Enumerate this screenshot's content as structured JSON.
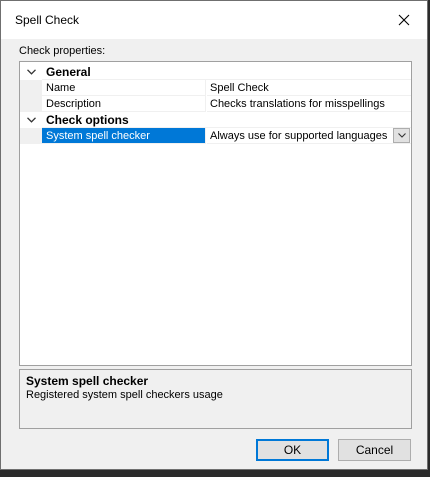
{
  "window": {
    "title": "Spell Check"
  },
  "section_label": "Check properties:",
  "grid": {
    "categories": [
      {
        "label": "General",
        "properties": [
          {
            "name": "Name",
            "value": "Spell Check"
          },
          {
            "name": "Description",
            "value": "Checks translations for misspellings"
          }
        ]
      },
      {
        "label": "Check options",
        "properties": [
          {
            "name": "System spell checker",
            "value": "Always use for supported languages",
            "selected": true
          }
        ]
      }
    ]
  },
  "description": {
    "title": "System spell checker",
    "text": "Registered system spell checkers usage"
  },
  "buttons": {
    "ok": "OK",
    "cancel": "Cancel"
  },
  "colors": {
    "accent": "#0078d7",
    "window_bg": "#f0f0f0"
  }
}
